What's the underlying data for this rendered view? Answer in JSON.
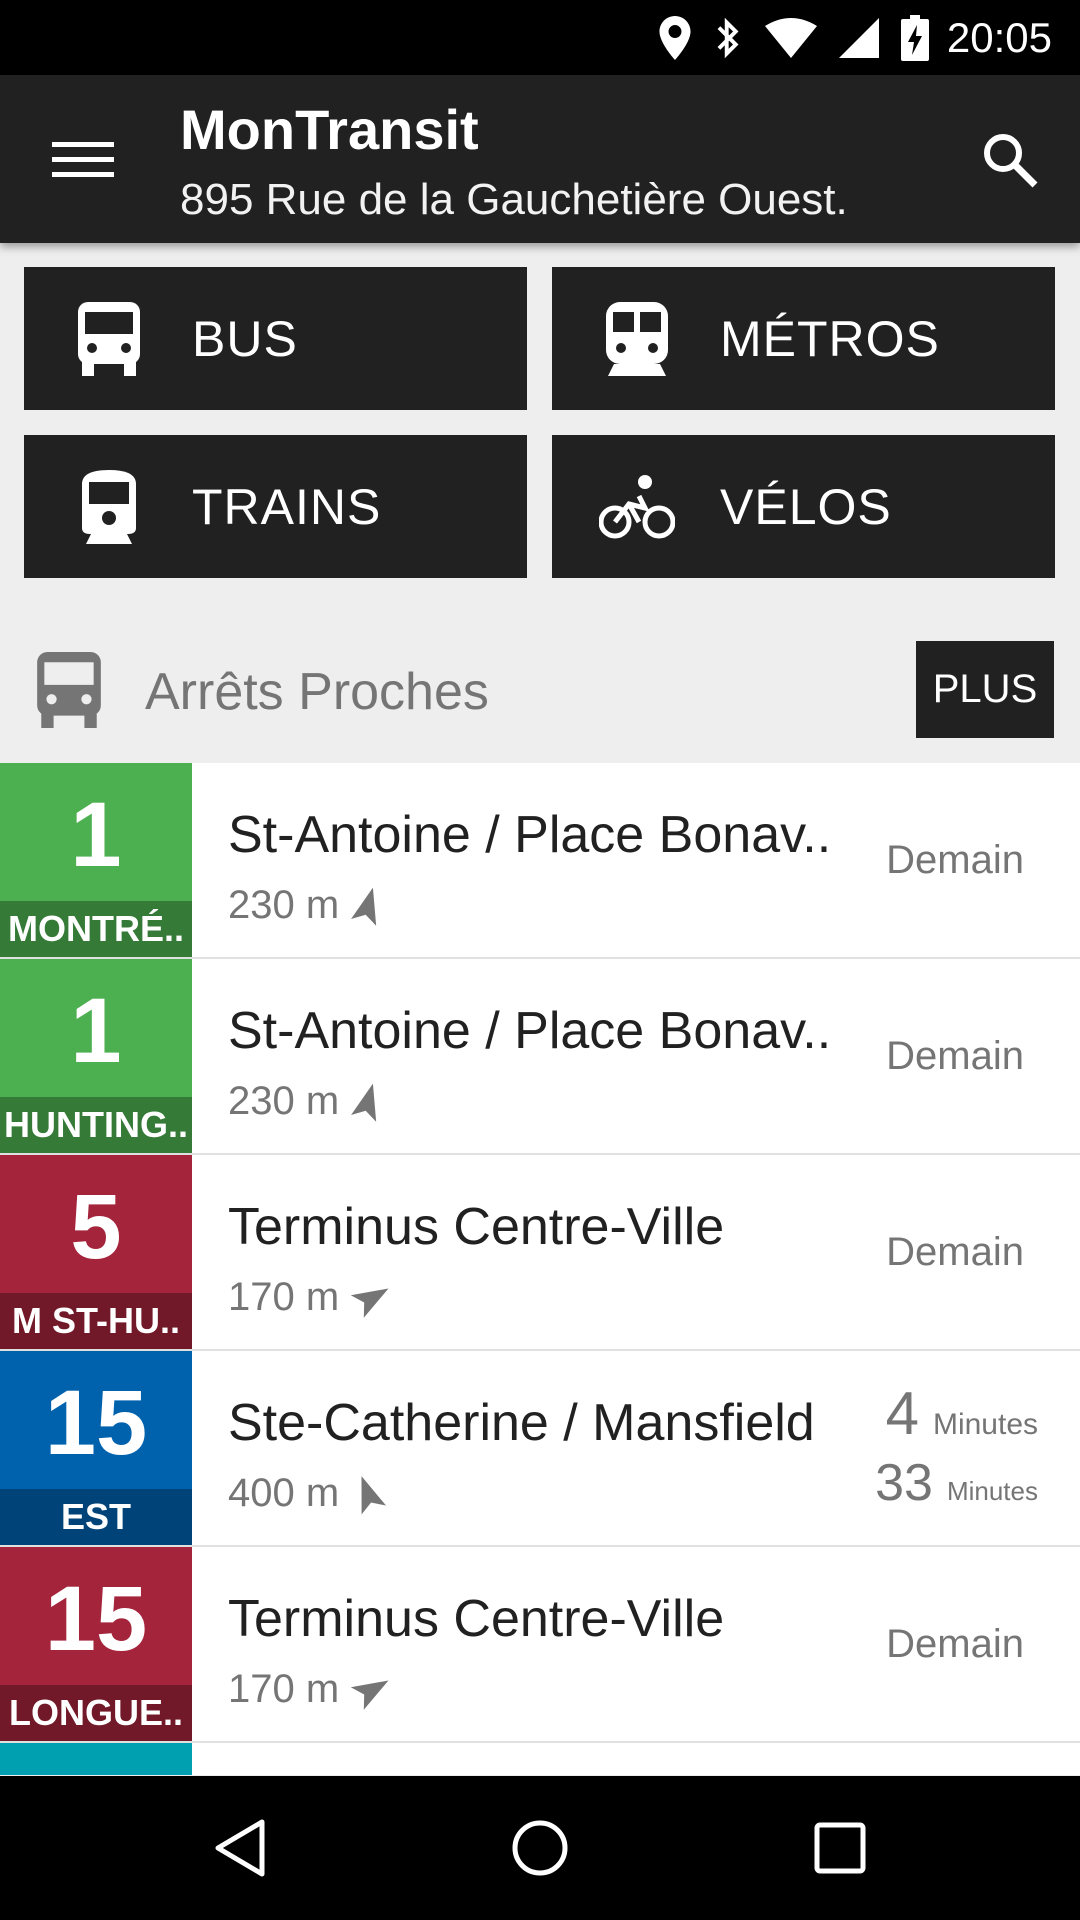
{
  "status_bar": {
    "time": "20:05",
    "icons": [
      "location-icon",
      "bluetooth-icon",
      "wifi-icon",
      "signal-icon",
      "battery-charging-icon"
    ]
  },
  "app_bar": {
    "title": "MonTransit",
    "subtitle": "895 Rue de la Gauchetière Ouest.",
    "menu_icon": "menu-icon",
    "search_icon": "search-icon"
  },
  "categories": [
    {
      "label": "BUS",
      "icon": "bus-icon"
    },
    {
      "label": "MÉTROS",
      "icon": "subway-icon"
    },
    {
      "label": "TRAINS",
      "icon": "train-icon"
    },
    {
      "label": "VÉLOS",
      "icon": "bike-icon"
    }
  ],
  "nearby": {
    "title": "Arrêts Proches",
    "icon": "bus-icon",
    "more_label": "PLUS"
  },
  "stops": [
    {
      "route": "1",
      "direction": "MONTRÉ..",
      "color": "#4CAF50",
      "name": "St-Antoine / Place Bonav..",
      "distance": "230 m",
      "time": "Demain"
    },
    {
      "route": "1",
      "direction": "HUNTING..",
      "color": "#4CAF50",
      "name": "St-Antoine / Place Bonav..",
      "distance": "230 m",
      "time": "Demain"
    },
    {
      "route": "5",
      "direction": "M ST-HU..",
      "color": "#A4243B",
      "name": "Terminus Centre-Ville",
      "distance": "170 m",
      "time": "Demain"
    },
    {
      "route": "15",
      "direction": "EST",
      "color": "#0061AD",
      "name": "Ste-Catherine / Mansfield",
      "distance": "400 m",
      "time_1_value": "4",
      "time_1_unit": "Minutes",
      "time_2_value": "33",
      "time_2_unit": "Minutes"
    },
    {
      "route": "15",
      "direction": "LONGUE..",
      "color": "#A4243B",
      "name": "Terminus Centre-Ville",
      "distance": "170 m",
      "time": "Demain"
    }
  ],
  "partial_stop_color": "#00A0B0",
  "nav_bar": {
    "back_icon": "back-icon",
    "home_icon": "home-icon",
    "recents_icon": "recents-icon"
  }
}
